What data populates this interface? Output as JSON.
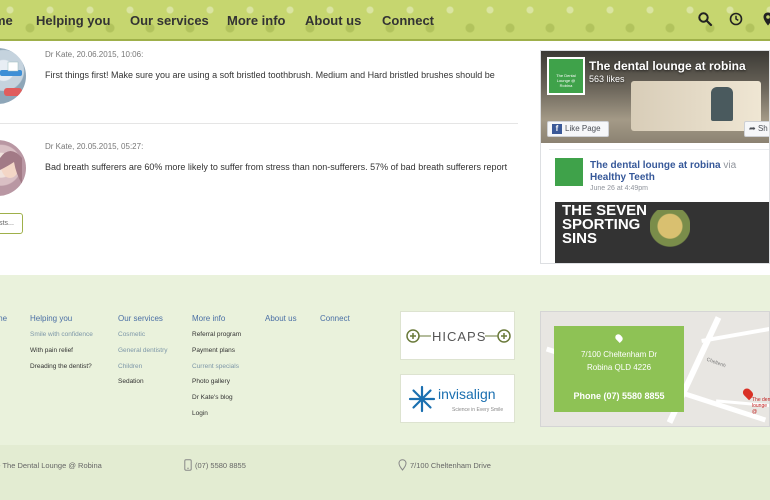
{
  "nav": {
    "items": [
      "me",
      "Helping you",
      "Our services",
      "More info",
      "About us",
      "Connect"
    ],
    "icons": [
      "search-icon",
      "clock-icon",
      "location-pin-icon"
    ]
  },
  "posts": [
    {
      "meta": "Dr Kate, 20.06.2015, 10:06:",
      "text": "First things first!  Make sure you are using a soft bristled toothbrush.  Medium and Hard bristled brushes should be"
    },
    {
      "meta": "Dr Kate, 20.05.2015, 05:27:",
      "text": "Bad breath sufferers are 60% more likely to suffer from stress than non-sufferers.  57% of bad breath sufferers report"
    }
  ],
  "more_button": "sts...",
  "facebook": {
    "page_title": "The dental lounge at robina",
    "likes": "563 likes",
    "like_label": "Like Page",
    "share_label": "Sh",
    "post_name": "The dental lounge at robina",
    "post_via": "via",
    "post_page": "Healthy Teeth",
    "post_date": "June 26 at 4:49pm",
    "banner_text": "THE SEVEN SPORTING SINS",
    "logo_text": "The Dental Lounge @ Robina"
  },
  "footer": {
    "col_home": "me",
    "col_helping": {
      "title": "Helping you",
      "links": [
        "Smile with confidence",
        "With pain relief",
        "Dreading the dentist?"
      ]
    },
    "col_services": {
      "title": "Our services",
      "links": [
        "Cosmetic",
        "General dentistry",
        "Children",
        "Sedation"
      ]
    },
    "col_more": {
      "title": "More info",
      "links": [
        "Referral program",
        "Payment plans",
        "Current specials",
        "Photo gallery",
        "Dr Kate's blog",
        "Login"
      ]
    },
    "col_about": {
      "title": "About us"
    },
    "col_connect": {
      "title": "Connect"
    },
    "partners": [
      {
        "name": "HICAPS"
      },
      {
        "name": "invisalign",
        "tagline": "Science in Every Smile"
      }
    ],
    "map": {
      "address_line1": "7/100 Cheltenham Dr",
      "address_line2": "Robina QLD 4226",
      "phone": "Phone (07) 5580 8855",
      "street_label": "Cheltenh",
      "marker_label": "The dent lounge @"
    }
  },
  "bottom_bar": {
    "copyright": "- The Dental Lounge @ Robina",
    "phone": "(07) 5580 8855",
    "address": "7/100 Cheltenham Drive"
  },
  "colors": {
    "nav_bg": "#c6d66f",
    "accent_green": "#8ec255",
    "footer_bg": "#eaf2dc",
    "link_blue": "#4a6fa5",
    "facebook_blue": "#365899"
  }
}
